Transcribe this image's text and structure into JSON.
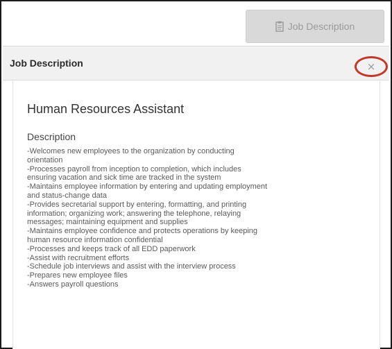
{
  "toolbar": {
    "job_description_button_label": "Job Description",
    "button_icon": "document-clipboard-icon"
  },
  "panel": {
    "title": "Job Description",
    "close_icon": "close-icon",
    "close_highlight_color": "#c0392b"
  },
  "job": {
    "title": "Human Resources Assistant",
    "section_label": "Description",
    "lines": [
      "-Welcomes new employees to the organization by conducting",
      "orientation",
      "-Processes payroll from inception to completion, which includes",
      "ensuring vacation and sick time are tracked in the system",
      "-Maintains employee information by entering and updating employment",
      "and status-change data",
      "-Provides secretarial support by entering, formatting, and printing",
      "information; organizing work; answering the telephone, relaying",
      "messages; maintaining equipment and supplies",
      "-Maintains employee confidence and protects operations by keeping",
      "human resource information confidential",
      "-Processes and keeps track of all EDD paperwork",
      "-Assist with recruitment efforts",
      "-Schedule job interviews and assist with the interview process",
      "-Prepares new employee files",
      "-Answers payroll questions"
    ]
  }
}
